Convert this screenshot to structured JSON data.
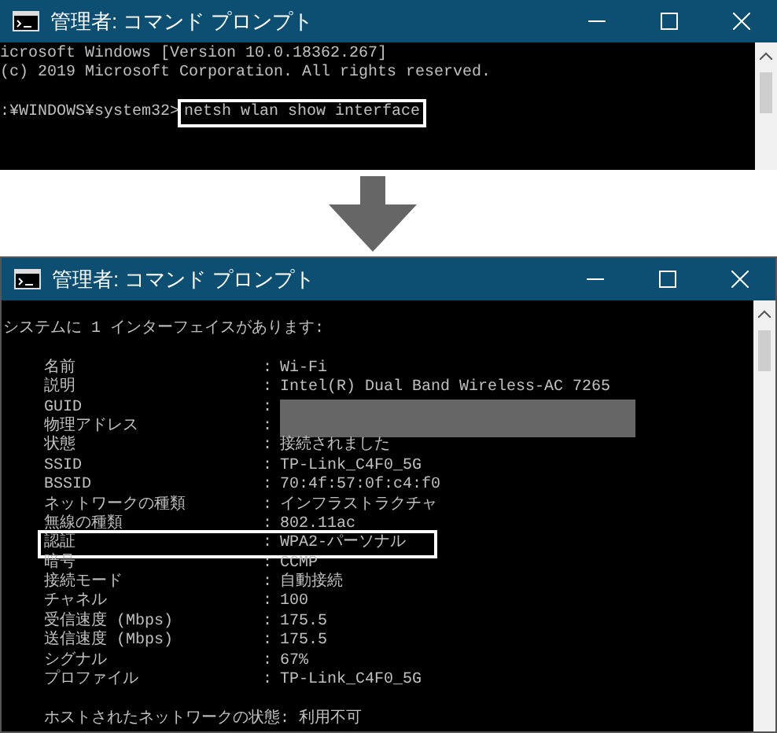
{
  "separator": ":",
  "windows": [
    {
      "title": "管理者: コマンド プロンプト",
      "lines": [
        {
          "kind": "text",
          "text": "icrosoft Windows [Version 10.0.18362.267]"
        },
        {
          "kind": "text",
          "text": "(c) 2019 Microsoft Corporation. All rights reserved."
        },
        {
          "kind": "blank"
        },
        {
          "kind": "prompt",
          "prompt": ":¥WINDOWS¥system32>",
          "command": "netsh wlan show interface",
          "highlighted": true
        }
      ]
    },
    {
      "title": "管理者: コマンド プロンプト",
      "lines": [
        {
          "kind": "text",
          "text": "システムに 1 インターフェイスがあります:"
        },
        {
          "kind": "blank"
        },
        {
          "kind": "field",
          "label": "名前",
          "value": "Wi-Fi",
          "highlighted": false,
          "redacted": false
        },
        {
          "kind": "field",
          "label": "説明",
          "value": "Intel(R) Dual Band Wireless-AC 7265",
          "highlighted": false,
          "redacted": false
        },
        {
          "kind": "field",
          "label": "GUID",
          "highlighted": false,
          "redacted": true
        },
        {
          "kind": "field",
          "label": "物理アドレス",
          "highlighted": false,
          "redacted": true
        },
        {
          "kind": "field",
          "label": "状態",
          "value": "接続されました",
          "highlighted": false,
          "redacted": false
        },
        {
          "kind": "field",
          "label": "SSID",
          "value": "TP-Link_C4F0_5G",
          "highlighted": false,
          "redacted": false
        },
        {
          "kind": "field",
          "label": "BSSID",
          "value": "70:4f:57:0f:c4:f0",
          "highlighted": false,
          "redacted": false
        },
        {
          "kind": "field",
          "label": "ネットワークの種類",
          "value": "インフラストラクチャ",
          "highlighted": false,
          "redacted": false
        },
        {
          "kind": "field",
          "label": "無線の種類",
          "value": "802.11ac",
          "highlighted": false,
          "redacted": false
        },
        {
          "kind": "field",
          "label": "認証",
          "value": "WPA2-パーソナル",
          "highlighted": true,
          "redacted": false
        },
        {
          "kind": "field",
          "label": "暗号",
          "value": "CCMP",
          "highlighted": false,
          "redacted": false
        },
        {
          "kind": "field",
          "label": "接続モード",
          "value": "自動接続",
          "highlighted": false,
          "redacted": false
        },
        {
          "kind": "field",
          "label": "チャネル",
          "value": "100",
          "highlighted": false,
          "redacted": false
        },
        {
          "kind": "field",
          "label": "受信速度 (Mbps)",
          "value": "175.5",
          "highlighted": false,
          "redacted": false
        },
        {
          "kind": "field",
          "label": "送信速度 (Mbps)",
          "value": "175.5",
          "highlighted": false,
          "redacted": false
        },
        {
          "kind": "field",
          "label": "シグナル",
          "value": "67%",
          "highlighted": false,
          "redacted": false
        },
        {
          "kind": "field",
          "label": "プロファイル",
          "value": "TP-Link_C4F0_5G",
          "highlighted": false,
          "redacted": false
        },
        {
          "kind": "blank"
        },
        {
          "kind": "text",
          "text": "ホストされたネットワークの状態: 利用不可",
          "indent": true
        }
      ]
    }
  ]
}
